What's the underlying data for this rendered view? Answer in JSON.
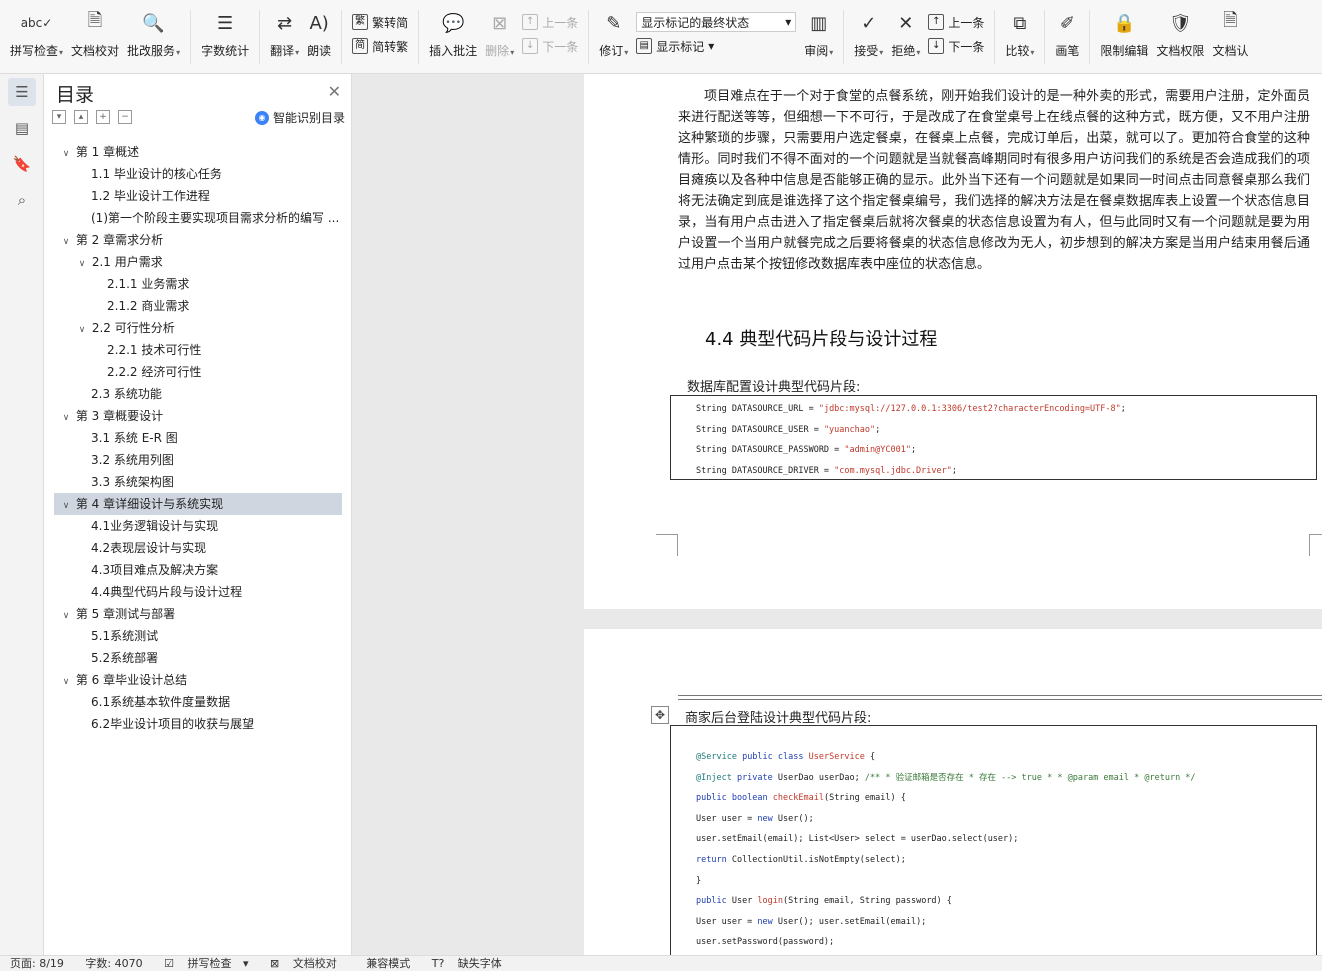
{
  "ribbon": {
    "spell_check": "拼写检查",
    "doc_check": "文档校对",
    "review_service": "批改服务",
    "word_count": "字数统计",
    "translate": "翻译",
    "read_aloud": "朗读",
    "trad_to_simp": "繁转简",
    "simp_to_trad": "简转繁",
    "insert_comment": "插入批注",
    "delete": "删除",
    "prev_comment": "上一条",
    "next_comment": "下一条",
    "revise": "修订",
    "markup_select": "显示标记的最终状态",
    "show_markup": "显示标记",
    "review_pane": "审阅",
    "accept": "接受",
    "reject": "拒绝",
    "prev_change": "上一条",
    "next_change": "下一条",
    "compare": "比较",
    "pen": "画笔",
    "restrict_edit": "限制编辑",
    "doc_permission": "文档权限",
    "doc_more": "文档认"
  },
  "toc": {
    "title": "目录",
    "smart_label": "智能识别目录",
    "items": [
      {
        "text": "第 1 章概述",
        "level": 1,
        "expanded": true
      },
      {
        "text": "1.1 毕业设计的核心任务",
        "level": 2
      },
      {
        "text": "1.2 毕业设计工作进程",
        "level": 2
      },
      {
        "text": "(1)第一个阶段主要实现项目需求分析的编写 ...",
        "level": 2
      },
      {
        "text": "第 2 章需求分析",
        "level": 1,
        "expanded": true
      },
      {
        "text": "2.1 用户需求",
        "level": 2,
        "expanded": true,
        "has_children": true
      },
      {
        "text": "2.1.1 业务需求",
        "level": 3
      },
      {
        "text": "2.1.2 商业需求",
        "level": 3
      },
      {
        "text": "2.2 可行性分析",
        "level": 2,
        "expanded": true,
        "has_children": true
      },
      {
        "text": "2.2.1 技术可行性",
        "level": 3
      },
      {
        "text": "2.2.2 经济可行性",
        "level": 3
      },
      {
        "text": "2.3 系统功能",
        "level": 2
      },
      {
        "text": "第 3 章概要设计",
        "level": 1,
        "expanded": true
      },
      {
        "text": "3.1 系统 E-R 图",
        "level": 2
      },
      {
        "text": "3.2 系统用列图",
        "level": 2
      },
      {
        "text": "3.3 系统架构图",
        "level": 2
      },
      {
        "text": "第 4 章详细设计与系统实现",
        "level": 1,
        "expanded": true,
        "active": true
      },
      {
        "text": "4.1业务逻辑设计与实现",
        "level": 2
      },
      {
        "text": "4.2表现层设计与实现",
        "level": 2
      },
      {
        "text": "4.3项目难点及解决方案",
        "level": 2
      },
      {
        "text": "4.4典型代码片段与设计过程",
        "level": 2
      },
      {
        "text": "第 5 章测试与部署",
        "level": 1,
        "expanded": true
      },
      {
        "text": "5.1系统测试",
        "level": 2
      },
      {
        "text": "5.2系统部署",
        "level": 2
      },
      {
        "text": "第 6 章毕业设计总结",
        "level": 1,
        "expanded": true
      },
      {
        "text": "6.1系统基本软件度量数据",
        "level": 2
      },
      {
        "text": "6.2毕业设计项目的收获与展望",
        "level": 2
      }
    ]
  },
  "document": {
    "paragraph": "项目难点在于一个对于食堂的点餐系统，刚开始我们设计的是一种外卖的形式，需要用户注册，定外面员来进行配送等等，但细想一下不可行，于是改成了在食堂桌号上在线点餐的这种方式，既方便，又不用户注册这种繁琐的步骤，只需要用户选定餐桌，在餐桌上点餐，完成订单后，出菜，就可以了。更加符合食堂的这种情形。同时我们不得不面对的一个问题就是当就餐高峰期同时有很多用户访问我们的系统是否会造成我们的项目瘫痪以及各种中信息是否能够正确的显示。此外当下还有一个问题就是如果同一时间点击同意餐桌那么我们将无法确定到底是谁选择了这个指定餐桌编号，我们选择的解决方法是在餐桌数据库表上设置一个状态信息目录，当有用户点击进入了指定餐桌后就将次餐桌的状态信息设置为有人，但与此同时又有一个问题就是要为用户设置一个当用户就餐完成之后要将餐桌的状态信息修改为无人，初步想到的解决方案是当用户结束用餐后通过用户点击某个按钮修改数据库表中座位的状态信息。",
    "heading": "4.4  典型代码片段与设计过程",
    "db_caption": "数据库配置设计典型代码片段:",
    "db_code": [
      {
        "pre": "String DATASOURCE_URL = ",
        "str": "\"jdbc:mysql://127.0.0.1:3306/test2?characterEncoding=UTF-8\"",
        "post": ";"
      },
      {
        "pre": "String DATASOURCE_USER = ",
        "str": "\"yuanchao\"",
        "post": ";"
      },
      {
        "pre": "String DATASOURCE_PASSWORD = ",
        "str": "\"admin@YC001\"",
        "post": ";"
      },
      {
        "pre": "String DATASOURCE_DRIVER = ",
        "str": "\"com.mysql.jdbc.Driver\"",
        "post": ";"
      }
    ],
    "login_caption": "商家后台登陆设计典型代码片段:",
    "login_code": {
      "l1_ann": "@Service",
      "l1_kw": " public class ",
      "l1_cls": "UserService",
      "l1_end": " {",
      "l2_ann": "@Inject",
      "l2_kw": " private ",
      "l2_mid": "UserDao userDao;",
      "l2_cm": " /** * 验证邮箱是否存在 * 存在 --> true * * @param email * @return */",
      "l3_kw": " public boolean ",
      "l3_fn": "checkEmail",
      "l3_end": "(String email) {",
      "l4_a": "User user = ",
      "l4_kw": "new",
      "l4_b": " User();",
      "l5": "user.setEmail(email); List<User> select = userDao.select(user);",
      "l6_kw": "return",
      "l6_b": " CollectionUtil.isNotEmpty(select);",
      "l7": "}",
      "l8_kw": "public",
      "l8_a": " User ",
      "l8_fn": "login",
      "l8_b": "(String email, String password) {",
      "l9_a": "User user = ",
      "l9_kw": "new",
      "l9_b": " User(); user.setEmail(email);",
      "l10": "user.setPassword(password);"
    }
  },
  "status": {
    "page": "页面: 8/19",
    "words": "字数: 4070",
    "spell": "拼写检查",
    "doc_check": "文档校对",
    "compat": "兼容模式",
    "missing_font": "缺失字体"
  }
}
